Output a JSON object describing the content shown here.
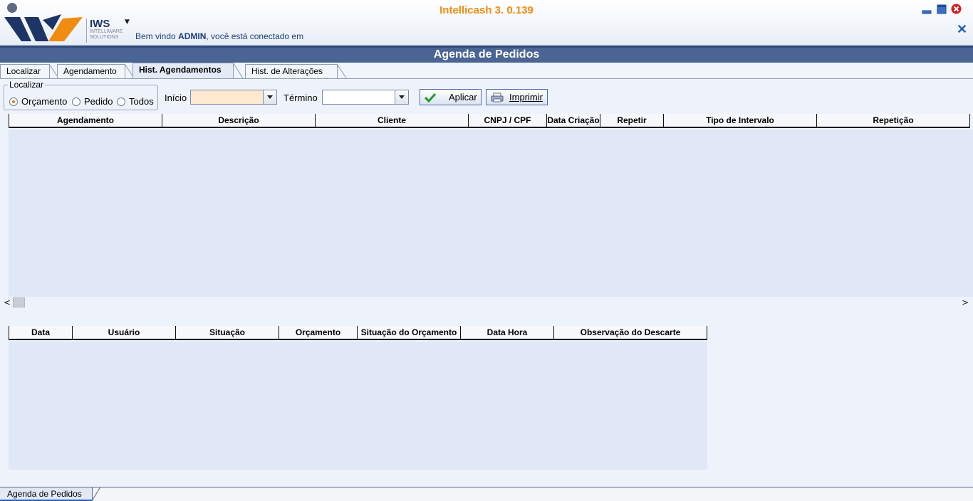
{
  "header": {
    "app_title": "Intellicash 3. 0.139",
    "welcome_prefix": "Bem vindo ",
    "welcome_user": "ADMIN",
    "welcome_suffix": ", você está conectado em",
    "logo_name": "IWS",
    "logo_sub1": "INTELLIWARE",
    "logo_sub2": "SOLUTIONS"
  },
  "module": {
    "title": "Agenda de Pedidos"
  },
  "tabs": [
    {
      "label": "Localizar",
      "active": false
    },
    {
      "label": "Agendamento",
      "active": false
    },
    {
      "label": "Hist. Agendamentos",
      "active": true
    },
    {
      "label": "Hist. de Alterações",
      "active": false
    }
  ],
  "filter": {
    "group_label": "Localizar",
    "options": [
      {
        "label": "Orçamento",
        "selected": true
      },
      {
        "label": "Pedido",
        "selected": false
      },
      {
        "label": "Todos",
        "selected": false
      }
    ],
    "inicio_label": "Início",
    "inicio_value": "",
    "termino_label": "Término",
    "termino_value": "",
    "apply_label": "Aplicar",
    "print_label": "Imprimir"
  },
  "grid_top": {
    "columns": [
      "Agendamento",
      "Descrição",
      "Cliente",
      "CNPJ / CPF",
      "Data Criação",
      "Repetir",
      "Tipo de Intervalo",
      "Repetição"
    ],
    "rows": []
  },
  "grid_bottom": {
    "columns": [
      "Data",
      "Usuário",
      "Situação",
      "Orçamento",
      "Situação do Orçamento",
      "Data Hora",
      "Observação do Descarte"
    ],
    "rows": []
  },
  "taskbar": {
    "open_window": "Agenda de Pedidos"
  },
  "colors": {
    "accent_orange": "#f08c10",
    "title_bar": "#4a6594",
    "grid_bg": "#e0e8f8",
    "close_red": "#d42020"
  }
}
